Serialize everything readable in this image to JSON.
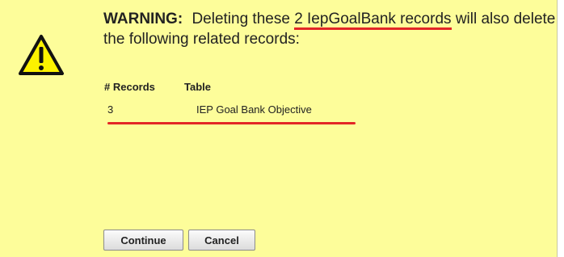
{
  "dialog": {
    "warning_label": "WARNING:",
    "message_before": "Deleting these",
    "message_highlight": "2 IepGoalBank records",
    "message_after": "will also delete the following related records:",
    "icon": "warning-triangle-icon",
    "accent_color": "#e32626",
    "background_color": "#fdfd9a"
  },
  "table": {
    "headers": [
      "# Records",
      "Table"
    ],
    "rows": [
      {
        "count": "3",
        "table": "IEP Goal Bank Objective"
      }
    ]
  },
  "buttons": {
    "continue_label": "Continue",
    "cancel_label": "Cancel"
  }
}
